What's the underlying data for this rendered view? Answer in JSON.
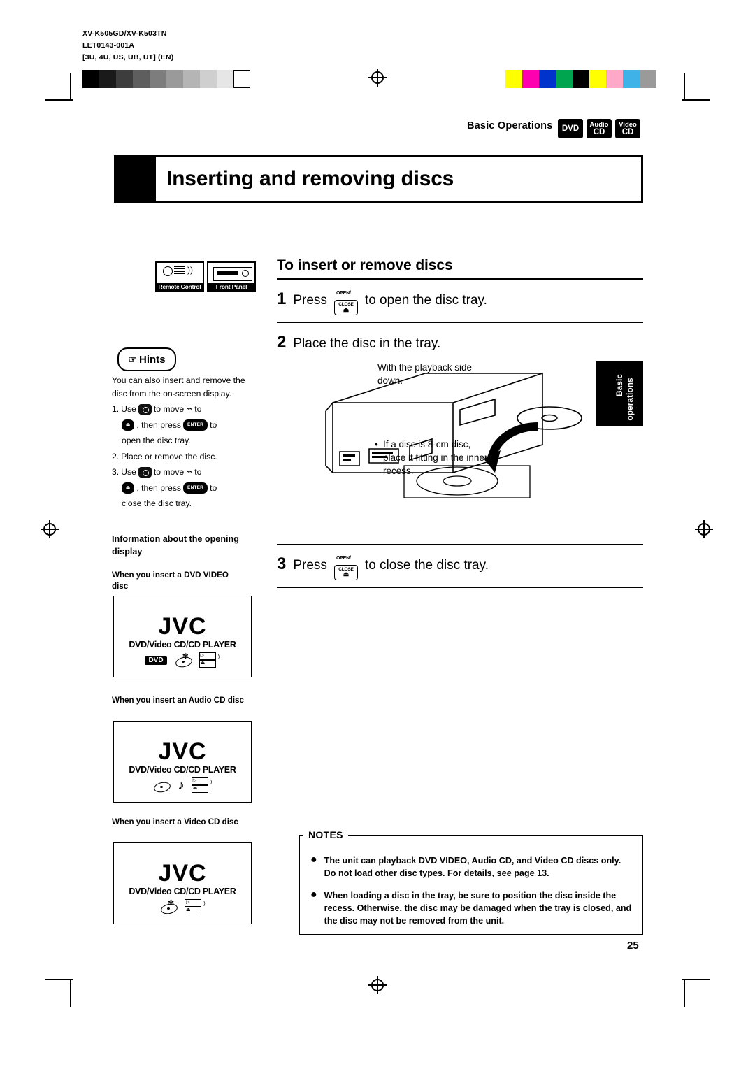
{
  "meta": {
    "line1": "XV-K505GD/XV-K503TN",
    "line2": "LET0143-001A",
    "line3": "[3U, 4U, US, UB, UT]  (EN)"
  },
  "header": {
    "section_label": "Basic Operations",
    "badges": [
      {
        "name": "dvd-badge",
        "line1": "DVD",
        "line2": ""
      },
      {
        "name": "audio-cd-badge",
        "line1": "Audio",
        "line2": "CD"
      },
      {
        "name": "video-cd-badge",
        "line1": "Video",
        "line2": "CD"
      }
    ]
  },
  "title": "Inserting and removing discs",
  "device_icons": [
    {
      "name": "remote-control-icon",
      "caption": "Remote Control"
    },
    {
      "name": "front-panel-icon",
      "caption": "Front Panel"
    }
  ],
  "hints": {
    "badge": "Hints",
    "intro": "You can also insert and remove the disc from the on-screen display.",
    "steps": [
      {
        "num": "1.",
        "a": "Use",
        "b": "to move",
        "c": "to",
        "d": ", then press",
        "e": "to",
        "f": "open the disc tray.",
        "btn1": "OPEN/CLOSE",
        "btn2": "ENTER"
      },
      {
        "num": "2.",
        "text": "Place or remove the disc."
      },
      {
        "num": "3.",
        "a": "Use",
        "b": "to move",
        "c": "to",
        "d": ", then press",
        "e": "to",
        "f": "close the disc tray.",
        "btn1": "OPEN/CLOSE",
        "btn2": "ENTER"
      }
    ],
    "info_heading": "Information about the opening display",
    "cases": [
      {
        "label": "When you insert a DVD VIDEO disc",
        "logo": "JVC",
        "sub": "DVD/Video CD/CD PLAYER",
        "icons": [
          "dvd-tag-icon",
          "disc-video-icon",
          "tray-icon"
        ]
      },
      {
        "label": "When you insert an Audio CD disc",
        "logo": "JVC",
        "sub": "DVD/Video CD/CD PLAYER",
        "icons": [
          "disc-audio-icon",
          "music-note-icon",
          "tray-icon"
        ]
      },
      {
        "label": "When you insert a Video CD disc",
        "logo": "JVC",
        "sub": "DVD/Video CD/CD PLAYER",
        "icons": [
          "disc-video-icon",
          "tray-icon"
        ]
      }
    ]
  },
  "main": {
    "section_title": "To insert or remove discs",
    "steps": [
      {
        "num": "1",
        "pre": "Press",
        "button": {
          "top": "OPEN/",
          "bottom": "CLOSE"
        },
        "post": "to open the disc tray."
      },
      {
        "num": "2",
        "text": "Place the disc in the tray."
      },
      {
        "num": "3",
        "pre": "Press",
        "button": {
          "top": "OPEN/",
          "bottom": "CLOSE"
        },
        "post": "to close the disc tray."
      }
    ],
    "illustration_captions": {
      "playback_side": "With the playback side down.",
      "eight_cm": "If a disc is 8-cm disc, place it fitting in the inner recess."
    },
    "side_tab": {
      "line1": "Basic",
      "line2": "operations"
    }
  },
  "notes": {
    "label": "NOTES",
    "items": [
      "The unit can playback DVD VIDEO, Audio CD, and Video CD discs only.  Do not load other disc types. For details, see page 13.",
      "When loading a disc in the tray, be sure to position the disc inside the recess. Otherwise, the disc may be damaged when the tray is closed, and the disc may not be removed from the unit."
    ]
  },
  "page_number": "25",
  "colors": {
    "ink": "#000000",
    "paper": "#ffffff",
    "color_strip": [
      "#ffff00",
      "#ff00b0",
      "#0033cc",
      "#00a64f",
      "#000000",
      "#ffff00",
      "#ffa8c8",
      "#3fb2e8",
      "#9a9a9a"
    ]
  }
}
